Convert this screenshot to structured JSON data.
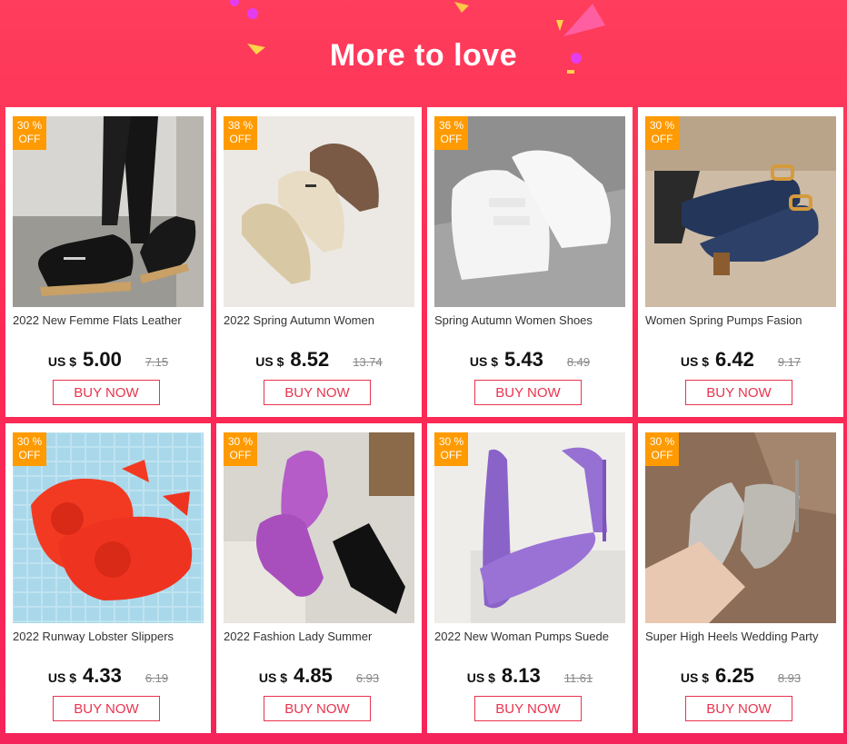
{
  "header": {
    "title": "More to love"
  },
  "colors": {
    "background": "#fb2a55",
    "badge": "#ff9a00",
    "button_border": "#e8344e"
  },
  "products": [
    {
      "discount_value": "30 %",
      "discount_label": "OFF",
      "name": "2022 New Femme Flats Leather",
      "currency": "US $",
      "price": "5.00",
      "old_price": "7.15",
      "button": "BUY NOW"
    },
    {
      "discount_value": "38 %",
      "discount_label": "OFF",
      "name": "2022 Spring Autumn Women",
      "currency": "US $",
      "price": "8.52",
      "old_price": "13.74",
      "button": "BUY NOW"
    },
    {
      "discount_value": "36 %",
      "discount_label": "OFF",
      "name": "Spring Autumn Women Shoes",
      "currency": "US $",
      "price": "5.43",
      "old_price": "8.49",
      "button": "BUY NOW"
    },
    {
      "discount_value": "30 %",
      "discount_label": "OFF",
      "name": "Women Spring Pumps Fasion",
      "currency": "US $",
      "price": "6.42",
      "old_price": "9.17",
      "button": "BUY NOW"
    },
    {
      "discount_value": "30 %",
      "discount_label": "OFF",
      "name": "2022 Runway Lobster Slippers",
      "currency": "US $",
      "price": "4.33",
      "old_price": "6.19",
      "button": "BUY NOW"
    },
    {
      "discount_value": "30 %",
      "discount_label": "OFF",
      "name": "2022 Fashion Lady Summer",
      "currency": "US $",
      "price": "4.85",
      "old_price": "6.93",
      "button": "BUY NOW"
    },
    {
      "discount_value": "30 %",
      "discount_label": "OFF",
      "name": "2022 New Woman Pumps Suede",
      "currency": "US $",
      "price": "8.13",
      "old_price": "11.61",
      "button": "BUY NOW"
    },
    {
      "discount_value": "30 %",
      "discount_label": "OFF",
      "name": "Super High Heels Wedding Party",
      "currency": "US $",
      "price": "6.25",
      "old_price": "8.93",
      "button": "BUY NOW"
    }
  ]
}
